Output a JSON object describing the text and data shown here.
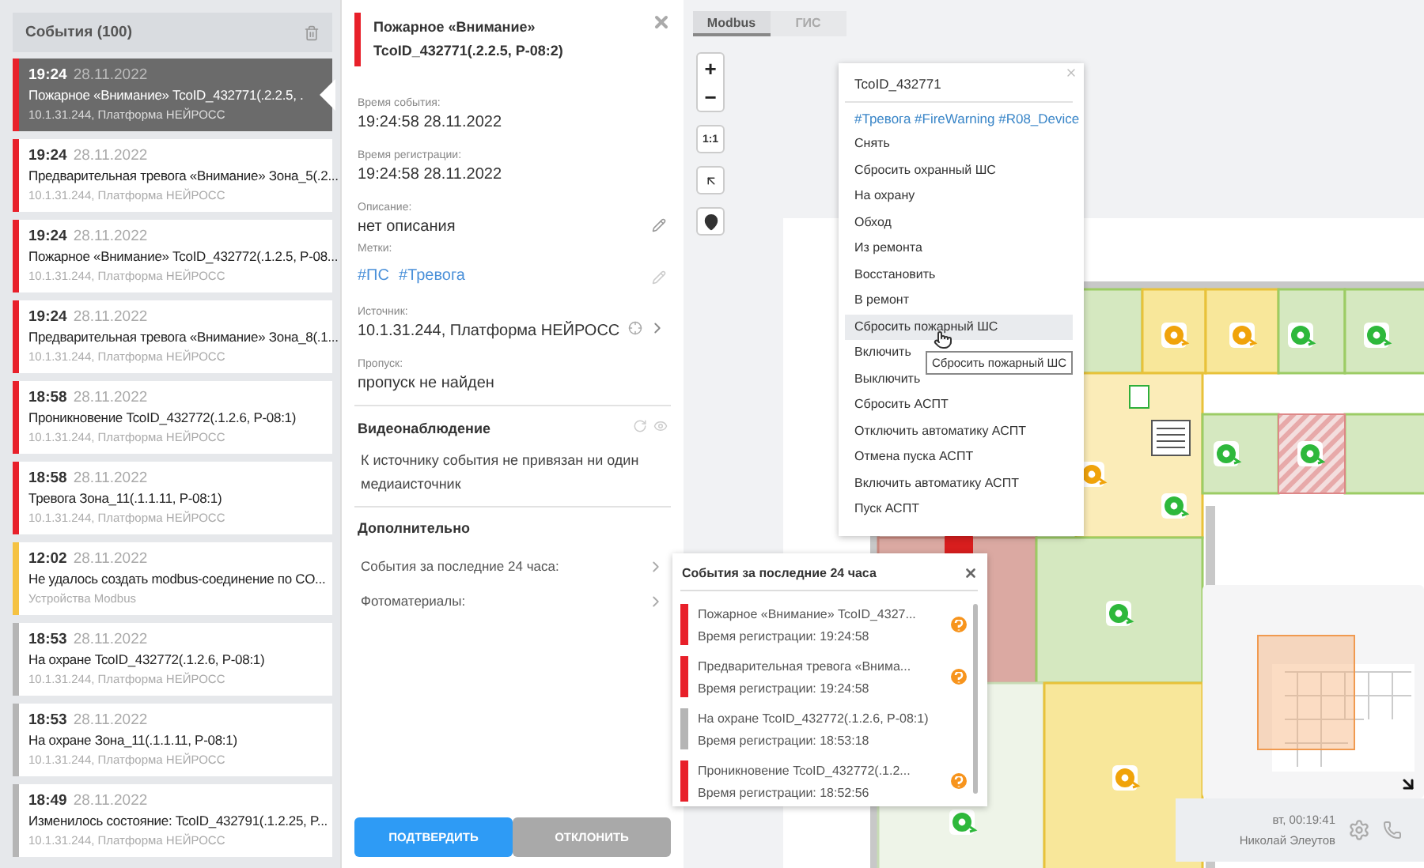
{
  "events_panel": {
    "title": "События (100)",
    "events": [
      {
        "time": "19:24",
        "date": "28.11.2022",
        "title": "Пожарное «Внимание» TcoID_432771(.2.2.5, .",
        "source": "10.1.31.244, Платформа НЕЙРОСС",
        "color": "#e8202a",
        "selected": true
      },
      {
        "time": "19:24",
        "date": "28.11.2022",
        "title": "Предварительная тревога «Внимание» Зона_5(.2...",
        "source": "10.1.31.244, Платформа НЕЙРОСС",
        "color": "#e8202a",
        "selected": false
      },
      {
        "time": "19:24",
        "date": "28.11.2022",
        "title": "Пожарное «Внимание» TcoID_432772(.1.2.5, P-08...",
        "source": "10.1.31.244, Платформа НЕЙРОСС",
        "color": "#e8202a",
        "selected": false
      },
      {
        "time": "19:24",
        "date": "28.11.2022",
        "title": "Предварительная тревога «Внимание» Зона_8(.1...",
        "source": "10.1.31.244, Платформа НЕЙРОСС",
        "color": "#e8202a",
        "selected": false
      },
      {
        "time": "18:58",
        "date": "28.11.2022",
        "title": "Проникновение TcoID_432772(.1.2.6, P-08:1)",
        "source": "10.1.31.244, Платформа НЕЙРОСС",
        "color": "#e8202a",
        "selected": false
      },
      {
        "time": "18:58",
        "date": "28.11.2022",
        "title": "Тревога Зона_11(.1.1.11, P-08:1)",
        "source": "10.1.31.244, Платформа НЕЙРОСС",
        "color": "#e8202a",
        "selected": false
      },
      {
        "time": "12:02",
        "date": "28.11.2022",
        "title": "Не удалось создать modbus-соединение по CO...",
        "source": "Устройства Modbus",
        "color": "#f5c242",
        "selected": false
      },
      {
        "time": "18:53",
        "date": "28.11.2022",
        "title": "На охране TcoID_432772(.1.2.6, P-08:1)",
        "source": "10.1.31.244, Платформа НЕЙРОСС",
        "color": "#b5b5b5",
        "selected": false
      },
      {
        "time": "18:53",
        "date": "28.11.2022",
        "title": "На охране Зона_11(.1.1.11, P-08:1)",
        "source": "10.1.31.244, Платформа НЕЙРОСС",
        "color": "#b5b5b5",
        "selected": false
      },
      {
        "time": "18:49",
        "date": "28.11.2022",
        "title": "Изменилось состояние: TcoID_432791(.1.2.25, P...",
        "source": "10.1.31.244, Платформа НЕЙРОСС",
        "color": "#b5b5b5",
        "selected": false
      }
    ]
  },
  "detail": {
    "color": "#e8202a",
    "title_lines": [
      "Пожарное «Внимание»",
      "TcoID_432771(.2.2.5, P-08:2)"
    ],
    "fields": [
      {
        "kind": "text",
        "label": "Время события:",
        "value": "19:24:58 28.11.2022"
      },
      {
        "kind": "text",
        "label": "Время регистрации:",
        "value": "19:24:58 28.11.2022"
      },
      {
        "kind": "editable",
        "label": "Описание:",
        "value": "нет описания"
      },
      {
        "kind": "tags",
        "label": "Метки:",
        "tags": [
          "#ПС",
          "#Тревога"
        ]
      },
      {
        "kind": "link",
        "label": "Источник:",
        "value": "10.1.31.244, Платформа НЕЙРОСС"
      },
      {
        "kind": "text",
        "label": "Пропуск:",
        "value": "пропуск не найден"
      }
    ],
    "video": {
      "title": "Видеонаблюдение",
      "text": "К источнику события не привязан ни один медиаисточник"
    },
    "extra": {
      "title": "Дополнительно",
      "rows": [
        "События за последние 24 часа:",
        "Фотоматериалы:"
      ]
    },
    "buttons": [
      {
        "label": "ПОДТВЕРДИТЬ",
        "kind": "primary"
      },
      {
        "label": "ОТКЛОНИТЬ",
        "kind": "secondary"
      }
    ]
  },
  "map": {
    "tabs": [
      {
        "label": "Modbus",
        "selected": true
      },
      {
        "label": "ГИС",
        "selected": false
      }
    ],
    "zoom_buttons": [
      "+",
      "−"
    ],
    "scale_button": "1:1",
    "context_menu": {
      "title": "TcoID_432771",
      "tags": "#Тревога #FireWarning #R08_Device",
      "items": [
        {
          "label": "Снять",
          "highlighted": false
        },
        {
          "label": "Сбросить охранный ШС",
          "highlighted": false
        },
        {
          "label": "На охрану",
          "highlighted": false
        },
        {
          "label": "Обход",
          "highlighted": false
        },
        {
          "label": "Из ремонта",
          "highlighted": false
        },
        {
          "label": "Восстановить",
          "highlighted": false
        },
        {
          "label": "В ремонт",
          "highlighted": false
        },
        {
          "label": "Сбросить пожарный ШС",
          "highlighted": true
        },
        {
          "label": "Включить",
          "highlighted": false
        },
        {
          "label": "Выключить",
          "highlighted": false
        },
        {
          "label": "Сбросить АСПТ",
          "highlighted": false
        },
        {
          "label": "Отключить автоматику АСПТ",
          "highlighted": false
        },
        {
          "label": "Отмена пуска АСПТ",
          "highlighted": false
        },
        {
          "label": "Включить автоматику АСПТ",
          "highlighted": false
        },
        {
          "label": "Пуск АСПТ",
          "highlighted": false
        }
      ]
    },
    "tooltip": "Сбросить пожарный ШС",
    "events_popup": {
      "title": "События за последние 24 часа",
      "items": [
        {
          "title": "Пожарное «Внимание» TcoID_4327...",
          "time": "Время регистрации: 19:24:58",
          "color": "#e8202a",
          "unconfirmed": true
        },
        {
          "title": "Предварительная тревога «Внима...",
          "time": "Время регистрации: 19:24:58",
          "color": "#e8202a",
          "unconfirmed": true
        },
        {
          "title": "На охране TcoID_432772(.1.2.6, P-08:1)",
          "time": "Время регистрации: 18:53:18",
          "color": "#b5b5b5",
          "unconfirmed": false
        },
        {
          "title": "Проникновение TcoID_432772(.1.2...",
          "time": "Время регистрации: 18:52:56",
          "color": "#e8202a",
          "unconfirmed": true
        }
      ]
    },
    "status": {
      "datetime": "вт, 00:19:41",
      "user": "Николай Элеутов"
    }
  }
}
